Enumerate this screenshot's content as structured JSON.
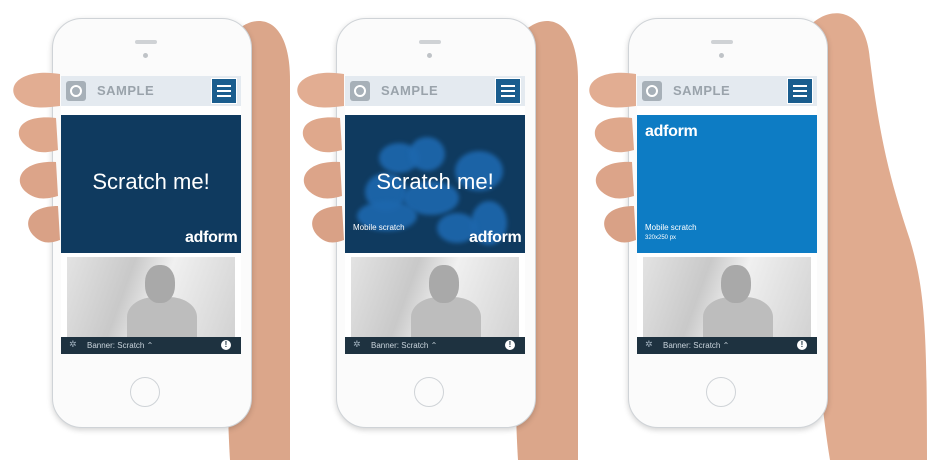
{
  "colors": {
    "banner_dark": "#0f3a5f",
    "banner_blue": "#0d7cc4",
    "menu_button": "#1a5d8e",
    "bottom_bar": "#1e3240",
    "scratch_blob": "#1d67ad"
  },
  "phones": [
    {
      "site_title": "SAMPLE",
      "banner_headline": "Scratch me!",
      "brand": "adform",
      "bar_label": "Banner: Scratch",
      "state": "unscratched"
    },
    {
      "site_title": "SAMPLE",
      "banner_headline": "Scratch me!",
      "brand": "adform",
      "caption": "Mobile scratch",
      "bar_label": "Banner: Scratch",
      "state": "scratching"
    },
    {
      "site_title": "SAMPLE",
      "brand": "adform",
      "caption": "Mobile scratch",
      "size_text": "320x250 px",
      "bar_label": "Banner: Scratch",
      "state": "revealed"
    }
  ],
  "icons": {
    "menu": "hamburger-icon",
    "logo": "circle-logo-icon",
    "settings": "gear-icon",
    "chevron": "chevron-up-icon",
    "info": "info-icon"
  }
}
